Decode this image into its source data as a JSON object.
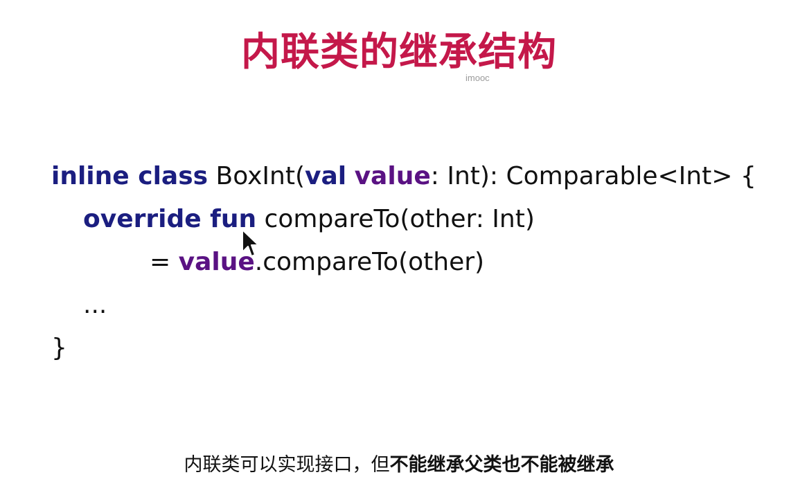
{
  "slide": {
    "title": "内联类的继承结构",
    "watermark": "imooc",
    "title_color": "#c4184a",
    "keyword_color": "#1b1e80",
    "property_color": "#5a1283",
    "code": {
      "line1": {
        "kw1": "inline class",
        "t1": " BoxInt(",
        "kw2": "val",
        "t2": " ",
        "prop": "value",
        "t3": ": Int): Comparable<Int> {"
      },
      "line2": {
        "indent": "  ",
        "kw": "override fun",
        "t1": " compareTo(other: Int)"
      },
      "line3": {
        "t1": "= ",
        "prop": "value",
        "t2": ".compareTo(other)"
      },
      "line4": {
        "t1": "..."
      },
      "line5": {
        "t1": "}"
      }
    },
    "subtitle": {
      "plain": "内联类可以实现接口，但",
      "bold": "不能继承父类也不能被继承"
    },
    "cursor_icon": "mouse-pointer-icon"
  }
}
